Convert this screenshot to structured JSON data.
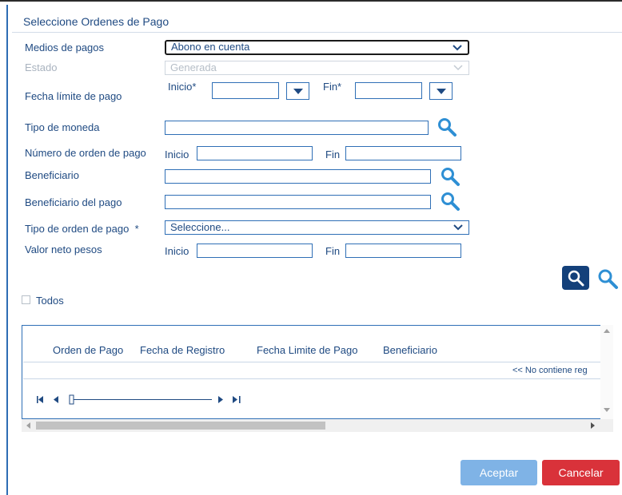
{
  "dialog": {
    "title": "Seleccione Ordenes de Pago"
  },
  "form": {
    "medios": {
      "label": "Medios de pagos",
      "value": "Abono en cuenta"
    },
    "estado": {
      "label": "Estado",
      "value": "Generada"
    },
    "fecha_limite": {
      "label": "Fecha límite de pago",
      "inicio_label": "Inicio*",
      "fin_label": "Fin*"
    },
    "tipo_moneda": {
      "label": "Tipo de moneda",
      "value": ""
    },
    "numero_orden": {
      "label": "Número de orden de pago",
      "inicio_label": "Inicio",
      "fin_label": "Fin"
    },
    "beneficiario": {
      "label": "Beneficiario",
      "value": ""
    },
    "beneficiario_pago": {
      "label": "Beneficiario del pago",
      "value": ""
    },
    "tipo_orden": {
      "label": "Tipo de orden de pago",
      "required_mark": "*",
      "value": "Seleccione..."
    },
    "valor_neto": {
      "label": "Valor neto pesos",
      "inicio_label": "Inicio",
      "fin_label": "Fin"
    }
  },
  "select_all": {
    "label": "Todos",
    "checked": false
  },
  "table": {
    "columns": [
      "Orden de Pago",
      "Fecha de Registro",
      "Fecha Limite de Pago",
      "Beneficiario"
    ],
    "empty_message": "<< No contiene reg"
  },
  "buttons": {
    "accept": "Aceptar",
    "cancel": "Cancelar"
  },
  "colors": {
    "primary": "#1f4a82",
    "accent_button": "#13407a",
    "accept": "#7fb3e6",
    "cancel": "#d9323a"
  },
  "icons": [
    "search-icon",
    "chevron-down-icon",
    "first-page-icon",
    "prev-page-icon",
    "next-page-icon",
    "last-page-icon"
  ]
}
